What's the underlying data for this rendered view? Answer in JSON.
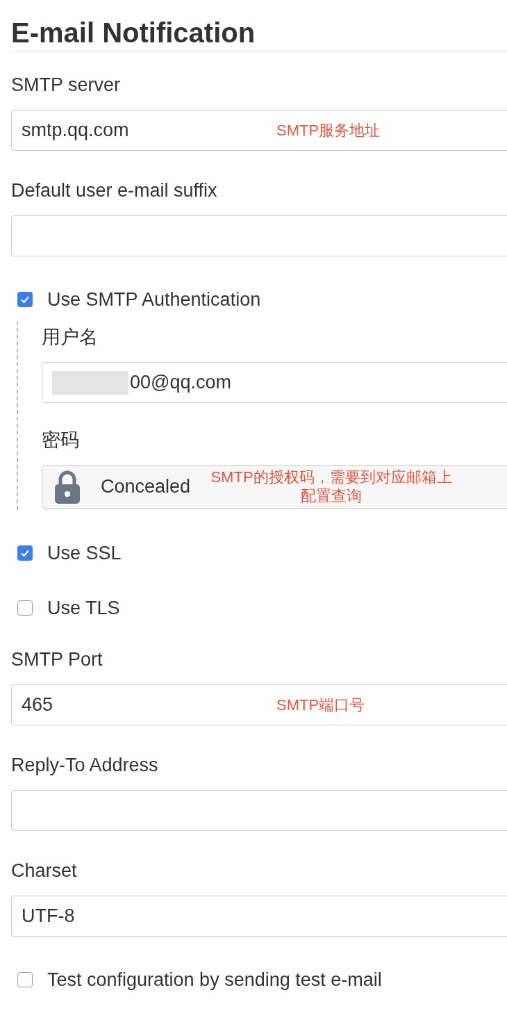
{
  "title": "E-mail Notification",
  "fields": [
    {
      "kind": "text_field",
      "label": "SMTP server",
      "value": "smtp.qq.com",
      "annotation": "SMTP服务地址"
    },
    {
      "kind": "text_field",
      "label": "Default user e-mail suffix"
    },
    {
      "kind": "checkbox",
      "label": "Use SMTP Authentication",
      "checked": true,
      "children": [
        {
          "kind": "text_field",
          "label": "用户名",
          "value": "00@qq.com",
          "redacted": true
        },
        {
          "kind": "secret_field",
          "label": "密码",
          "value": "Concealed",
          "annotation": "SMTP的授权码，需要到对应邮箱上配置查询"
        }
      ]
    },
    {
      "kind": "checkbox",
      "label": "Use SSL",
      "checked": true
    },
    {
      "kind": "checkbox",
      "label": "Use TLS",
      "checked": false
    },
    {
      "kind": "text_field",
      "label": "SMTP Port",
      "value": "465",
      "annotation": "SMTP端口号"
    },
    {
      "kind": "text_field",
      "label": "Reply-To Address"
    },
    {
      "kind": "text_field",
      "label": "Charset",
      "value": "UTF-8"
    },
    {
      "kind": "checkbox",
      "label": "Test configuration by sending test e-mail",
      "checked": false
    }
  ]
}
